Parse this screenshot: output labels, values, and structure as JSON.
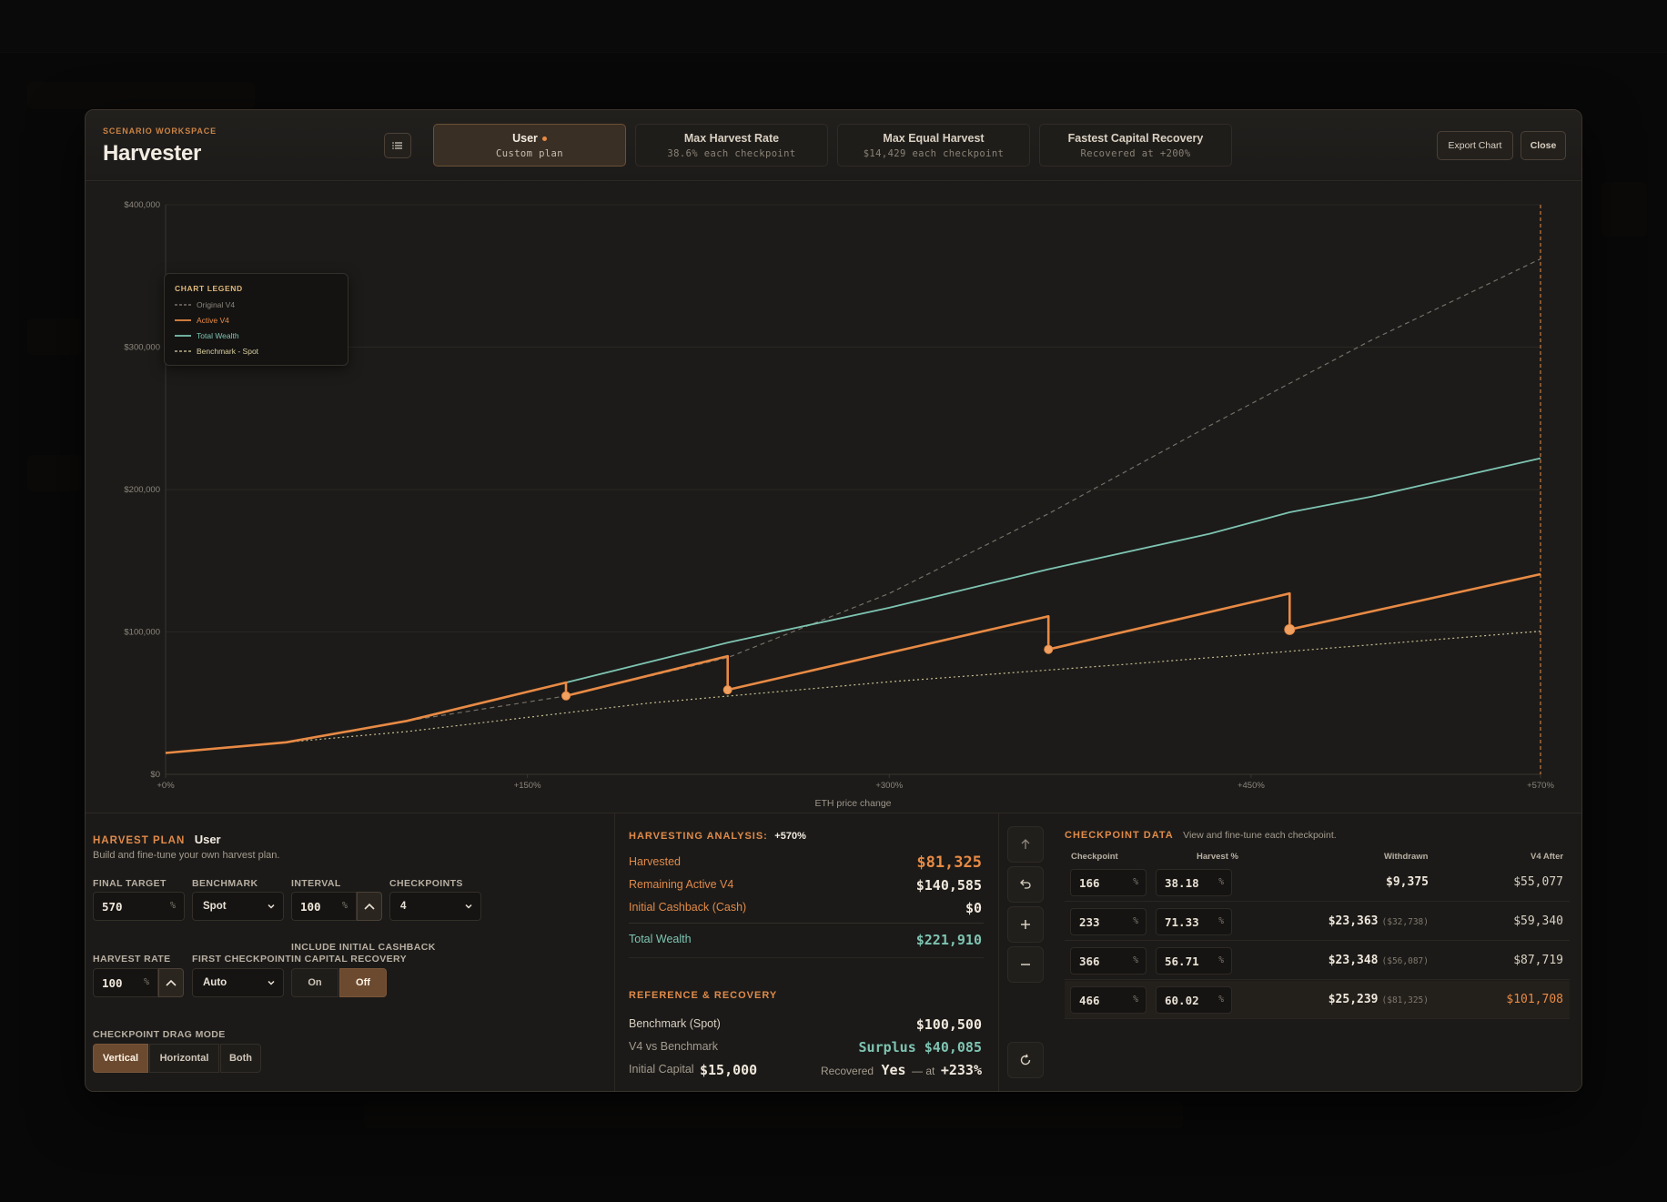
{
  "header": {
    "eyebrow": "SCENARIO WORKSPACE",
    "title": "Harvester",
    "export_label": "Export Chart",
    "close_label": "Close"
  },
  "tabs": [
    {
      "label": "User",
      "sub": "Custom plan",
      "active": true
    },
    {
      "label": "Max Harvest Rate",
      "sub": "38.6% each checkpoint",
      "active": false
    },
    {
      "label": "Max Equal Harvest",
      "sub": "$14,429 each checkpoint",
      "active": false
    },
    {
      "label": "Fastest Capital Recovery",
      "sub": "Recovered at +200%",
      "active": false
    }
  ],
  "legend": {
    "title": "CHART LEGEND",
    "items": [
      {
        "label": "Original V4",
        "color": "#8b857b",
        "dash": "dashed"
      },
      {
        "label": "Active V4",
        "color": "#e88a45",
        "dash": "solid"
      },
      {
        "label": "Total Wealth",
        "color": "#7ec4b2",
        "dash": "solid"
      },
      {
        "label": "Benchmark - Spot",
        "color": "#d9cf9e",
        "dash": "dashed"
      }
    ]
  },
  "chart_data": {
    "type": "line",
    "xlabel": "ETH price change",
    "x_ticks": [
      "+0%",
      "+150%",
      "+300%",
      "+450%",
      "+570%"
    ],
    "y_ticks": [
      "$0",
      "$100,000",
      "$200,000",
      "$300,000",
      "$400,000"
    ],
    "xlim": [
      0,
      570
    ],
    "ylim": [
      0,
      400000
    ],
    "series": [
      {
        "name": "Original V4",
        "color": "#8b857b",
        "x": [
          0,
          50,
          100,
          166,
          233,
          300,
          366,
          433,
          500,
          570
        ],
        "y": [
          15000,
          22500,
          37500,
          55000,
          82000,
          127000,
          183000,
          245000,
          305000,
          362000
        ]
      },
      {
        "name": "Total Wealth",
        "color": "#7ec4b2",
        "x": [
          0,
          50,
          100,
          166,
          233,
          300,
          366,
          433,
          466,
          500,
          570
        ],
        "y": [
          15000,
          22500,
          37500,
          64500,
          92500,
          117000,
          144000,
          169000,
          184000,
          195000,
          222000
        ]
      },
      {
        "name": "Benchmark - Spot",
        "color": "#d9cf9e",
        "x": [
          0,
          100,
          200,
          300,
          400,
          500,
          570
        ],
        "y": [
          15000,
          30000,
          50000,
          65000,
          77500,
          91000,
          100500
        ]
      },
      {
        "name": "Active V4",
        "color": "#e88a45",
        "x": [
          0,
          50,
          100,
          166,
          166,
          233,
          233,
          366,
          366,
          466,
          466,
          570
        ],
        "y": [
          15000,
          22500,
          37500,
          64500,
          55077,
          83000,
          59340,
          111000,
          87719,
          127000,
          101708,
          140585
        ]
      }
    ],
    "checkpoints": [
      {
        "x": 166,
        "y": 55077
      },
      {
        "x": 233,
        "y": 59340
      },
      {
        "x": 366,
        "y": 87719
      },
      {
        "x": 466,
        "y": 101708
      }
    ]
  },
  "plan": {
    "title": "HARVEST PLAN",
    "mode": "User",
    "desc": "Build and fine-tune your own harvest plan.",
    "final_target_label": "FINAL TARGET",
    "final_target": "570",
    "pct": "%",
    "benchmark_label": "BENCHMARK",
    "benchmark": "Spot",
    "interval_label": "INTERVAL",
    "interval": "100",
    "checkpoints_label": "CHECKPOINTS",
    "checkpoints": "4",
    "harvest_rate_label": "HARVEST RATE",
    "harvest_rate": "100",
    "first_checkpoint_label": "FIRST CHECKPOINT",
    "first_checkpoint": "Auto",
    "cashback_label_1": "INCLUDE INITIAL CASHBACK",
    "cashback_label_2": "IN CAPITAL RECOVERY",
    "on_label": "On",
    "off_label": "Off",
    "drag_label": "CHECKPOINT DRAG MODE",
    "drag_vertical": "Vertical",
    "drag_horizontal": "Horizontal",
    "drag_both": "Both"
  },
  "analysis": {
    "title": "HARVESTING ANALYSIS:",
    "target": "+570%",
    "harvested_label": "Harvested",
    "harvested": "$81,325",
    "remaining_label": "Remaining Active V4",
    "remaining": "$140,585",
    "cashback_label": "Initial Cashback (Cash)",
    "cashback": "$0",
    "total_label": "Total Wealth",
    "total": "$221,910",
    "ref_title": "REFERENCE & RECOVERY",
    "benchmark_label": "Benchmark (Spot)",
    "benchmark": "$100,500",
    "vs_label": "V4 vs Benchmark",
    "vs": "Surplus $40,085",
    "capital_label": "Initial Capital",
    "capital": "$15,000",
    "recovered_label": "Recovered",
    "recovered": "Yes",
    "at_label": "— at",
    "at": "+233%"
  },
  "checkpoint_data": {
    "title": "CHECKPOINT DATA",
    "desc": "View and fine-tune each checkpoint.",
    "col_checkpoint": "Checkpoint",
    "col_harvest": "Harvest %",
    "col_withdrawn": "Withdrawn",
    "col_after": "V4 After",
    "rows": [
      {
        "checkpoint": "166",
        "harvest": "38.18",
        "withdrawn": "$9,375",
        "cumulative": "",
        "after": "$55,077"
      },
      {
        "checkpoint": "233",
        "harvest": "71.33",
        "withdrawn": "$23,363",
        "cumulative": "($32,738)",
        "after": "$59,340"
      },
      {
        "checkpoint": "366",
        "harvest": "56.71",
        "withdrawn": "$23,348",
        "cumulative": "($56,087)",
        "after": "$87,719"
      },
      {
        "checkpoint": "466",
        "harvest": "60.02",
        "withdrawn": "$25,239",
        "cumulative": "($81,325)",
        "after": "$101,708"
      }
    ]
  }
}
